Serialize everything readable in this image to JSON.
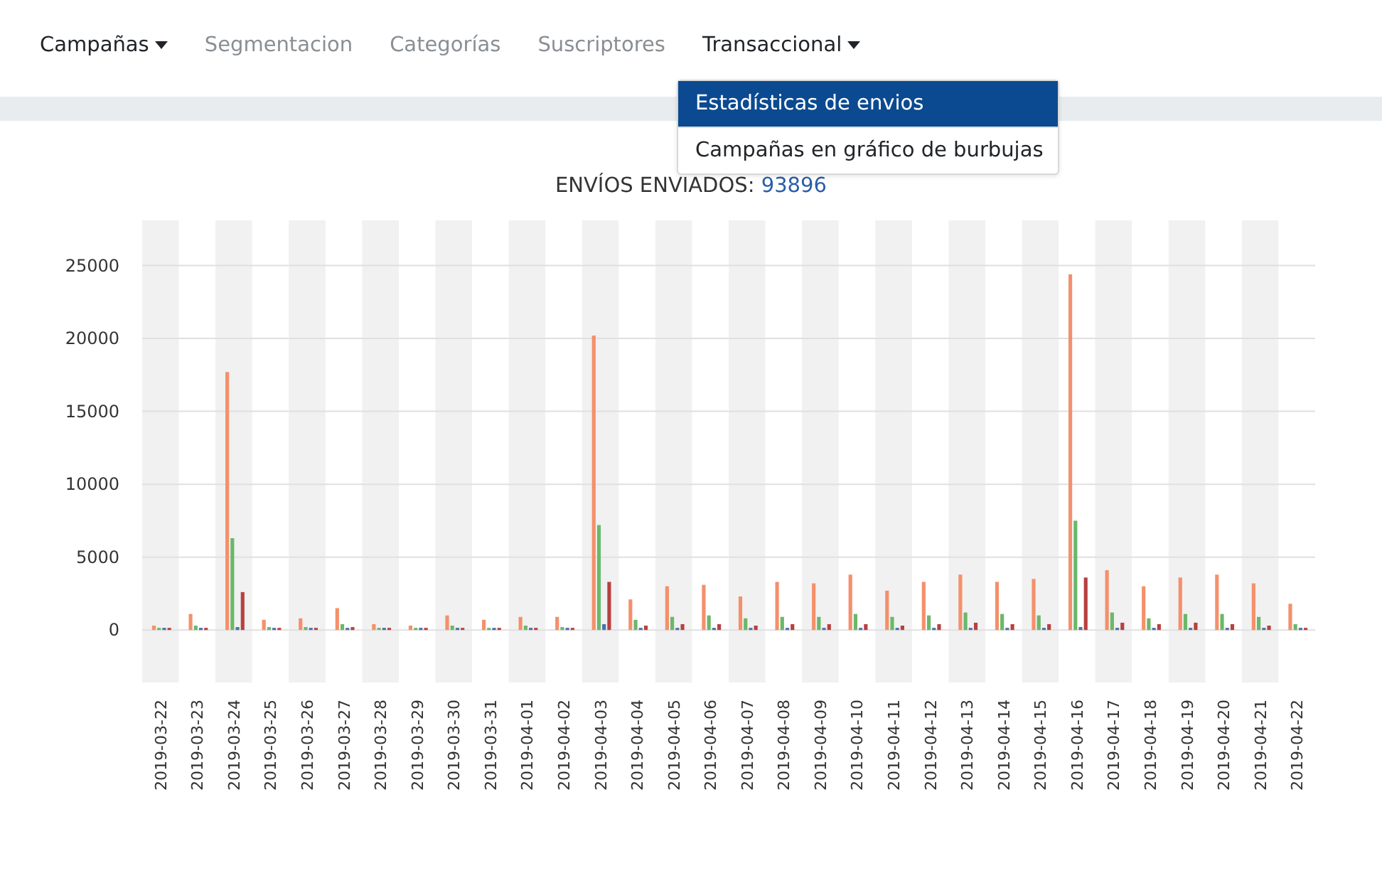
{
  "nav": {
    "items": [
      {
        "label": "Campañas",
        "active": true,
        "has_menu": true
      },
      {
        "label": "Segmentacion",
        "active": false,
        "has_menu": false
      },
      {
        "label": "Categorías",
        "active": false,
        "has_menu": false
      },
      {
        "label": "Suscriptores",
        "active": false,
        "has_menu": false
      },
      {
        "label": "Transaccional",
        "active": true,
        "has_menu": true
      }
    ]
  },
  "dropdown": {
    "items": [
      {
        "label": "Estadísticas de envios",
        "selected": true
      },
      {
        "label": "Campañas en gráfico de burbujas",
        "selected": false
      }
    ]
  },
  "chart": {
    "title": "ENVÍOS ENVIADOS: ",
    "total": "93896",
    "chart_data": {
      "type": "bar",
      "categories": [
        "2019-03-22",
        "2019-03-23",
        "2019-03-24",
        "2019-03-25",
        "2019-03-26",
        "2019-03-27",
        "2019-03-28",
        "2019-03-29",
        "2019-03-30",
        "2019-03-31",
        "2019-04-01",
        "2019-04-02",
        "2019-04-03",
        "2019-04-04",
        "2019-04-05",
        "2019-04-06",
        "2019-04-07",
        "2019-04-08",
        "2019-04-09",
        "2019-04-10",
        "2019-04-11",
        "2019-04-12",
        "2019-04-13",
        "2019-04-14",
        "2019-04-15",
        "2019-04-16",
        "2019-04-17",
        "2019-04-18",
        "2019-04-19",
        "2019-04-20",
        "2019-04-21",
        "2019-04-22"
      ],
      "series": [
        {
          "color": "#f4906b",
          "values": [
            300,
            1100,
            17700,
            700,
            800,
            1500,
            400,
            300,
            1000,
            700,
            900,
            900,
            20200,
            2100,
            3000,
            3100,
            2300,
            3300,
            3200,
            3800,
            2700,
            3300,
            3800,
            3300,
            3500,
            24400,
            4100,
            3000,
            3600,
            3800,
            3200,
            1800
          ]
        },
        {
          "color": "#6ab86a",
          "values": [
            100,
            300,
            6300,
            200,
            200,
            400,
            100,
            100,
            300,
            100,
            300,
            200,
            7200,
            700,
            900,
            1000,
            800,
            900,
            900,
            1100,
            900,
            1000,
            1200,
            1100,
            1000,
            7500,
            1200,
            800,
            1100,
            1100,
            900,
            400
          ]
        },
        {
          "color": "#4a6fb0",
          "values": [
            100,
            100,
            200,
            100,
            100,
            100,
            100,
            100,
            100,
            100,
            100,
            100,
            400,
            100,
            100,
            100,
            100,
            100,
            100,
            100,
            100,
            100,
            100,
            100,
            100,
            200,
            100,
            100,
            100,
            100,
            100,
            100
          ]
        },
        {
          "color": "#b84040",
          "values": [
            100,
            100,
            2600,
            100,
            100,
            200,
            100,
            100,
            100,
            100,
            100,
            100,
            3300,
            300,
            400,
            400,
            300,
            400,
            400,
            400,
            300,
            400,
            500,
            400,
            400,
            3600,
            500,
            400,
            500,
            400,
            300,
            100
          ]
        }
      ],
      "grid": true,
      "ylim": [
        -3600,
        28100
      ],
      "yticks": [
        0,
        5000,
        10000,
        15000,
        20000,
        25000
      ]
    }
  }
}
